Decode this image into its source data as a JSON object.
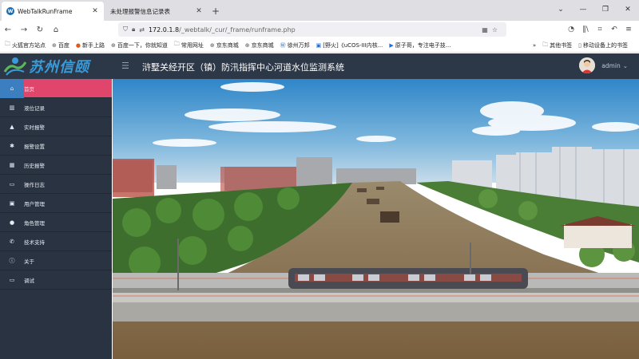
{
  "browser": {
    "tabs": [
      {
        "label": "WebTalkRunFrame",
        "favicon": "W",
        "active": true
      },
      {
        "label": "未处理报警信息记录表",
        "active": false
      }
    ],
    "url_host": "172.0.1.8",
    "url_path": "/_webtalk/_cur/_frame/runframe.php"
  },
  "bookmarks": [
    {
      "label": "火狐官方站点",
      "icon": "firefox-icon"
    },
    {
      "label": "百度",
      "icon": "globe-icon"
    },
    {
      "label": "新手上路",
      "icon": "firefox-icon"
    },
    {
      "label": "百度一下，你就知道",
      "icon": "globe-icon"
    },
    {
      "label": "常用网址",
      "icon": "folder-icon"
    },
    {
      "label": "京东商城",
      "icon": "globe-icon"
    },
    {
      "label": "京东商城",
      "icon": "globe-icon"
    },
    {
      "label": "徐州万邦",
      "icon": "w-icon"
    },
    {
      "label": "[野火]《uCOS-III内核...",
      "icon": "doc-icon"
    },
    {
      "label": "原子哥，专注电子技...",
      "icon": "play-icon"
    }
  ],
  "bookmarks_right": [
    {
      "label": "其他书签",
      "icon": "folder-icon"
    },
    {
      "label": "移动设备上的书签",
      "icon": "mobile-icon"
    }
  ],
  "app": {
    "logo_text": "苏州信颐",
    "system_title": "浒墅关经开区（镇）防汛指挥中心河道水位监测系统",
    "user_name": "admin",
    "user_caret": "⌄"
  },
  "sidebar": [
    {
      "label": "首页",
      "icon": "home-icon",
      "active": true
    },
    {
      "label": "液位记录",
      "icon": "chart-icon"
    },
    {
      "label": "实时报警",
      "icon": "warning-icon"
    },
    {
      "label": "报警设置",
      "icon": "gear-icon"
    },
    {
      "label": "历史报警",
      "icon": "calendar-icon"
    },
    {
      "label": "操作日志",
      "icon": "monitor-icon"
    },
    {
      "label": "用户管理",
      "icon": "user-card-icon"
    },
    {
      "label": "角色管理",
      "icon": "person-icon"
    },
    {
      "label": "技术支持",
      "icon": "phone-icon"
    },
    {
      "label": "关于",
      "icon": "info-icon"
    },
    {
      "label": "调试",
      "icon": "monitor-icon"
    }
  ],
  "colors": {
    "header_bg": "#2c3848",
    "sidebar_bg": "#2a3342",
    "active_item": "#e0456b",
    "active_icon_bg": "#3b7fc1",
    "logo": "#3a9bd9"
  }
}
